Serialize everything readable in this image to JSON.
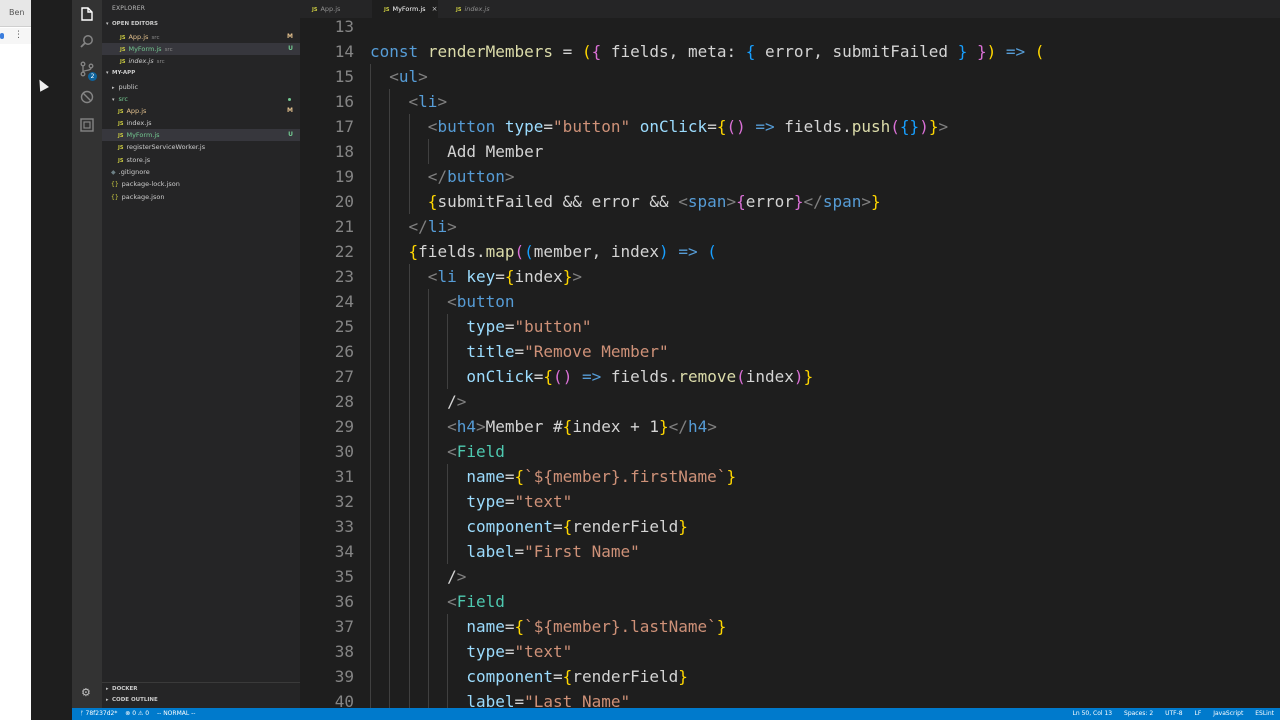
{
  "browser": {
    "user": "Ben",
    "menu_icon": "kebab-menu-icon"
  },
  "activity_bar": {
    "icons": [
      "files-icon",
      "search-icon",
      "source-control-icon",
      "debug-icon",
      "extensions-icon"
    ],
    "scm_badge": "2",
    "manage_icon": "gear-icon"
  },
  "sidebar": {
    "title": "EXPLORER",
    "open_editors": {
      "label": "OPEN EDITORS",
      "items": [
        {
          "name": "App.js",
          "dir": "src",
          "status": "M"
        },
        {
          "name": "MyForm.js",
          "dir": "src",
          "status": "U"
        },
        {
          "name": "index.js",
          "dir": "src",
          "status": ""
        }
      ]
    },
    "project": {
      "label": "MY-APP",
      "items": [
        {
          "name": "public",
          "status": ""
        },
        {
          "name": "src",
          "status": ""
        },
        {
          "name": "App.js",
          "status": "M"
        },
        {
          "name": "index.js",
          "status": ""
        },
        {
          "name": "MyForm.js",
          "status": "U"
        },
        {
          "name": "registerServiceWorker.js",
          "status": ""
        },
        {
          "name": "store.js",
          "status": ""
        },
        {
          "name": ".gitignore",
          "status": ""
        },
        {
          "name": "package-lock.json",
          "status": ""
        },
        {
          "name": "package.json",
          "status": ""
        }
      ]
    },
    "docker_label": "DOCKER",
    "outline_label": "CODE OUTLINE"
  },
  "tabs": [
    {
      "label": "App.js",
      "active": false
    },
    {
      "label": "MyForm.js",
      "active": true,
      "close": "×"
    },
    {
      "label": "index.js",
      "active": false
    }
  ],
  "editor": {
    "lines": [
      {
        "n": "13",
        "text": ""
      },
      {
        "n": "14",
        "text": "const renderMembers = ({ fields, meta: { error, submitFailed } }) => ("
      },
      {
        "n": "15",
        "text": "  <ul>"
      },
      {
        "n": "16",
        "text": "    <li>"
      },
      {
        "n": "17",
        "text": "      <button type=\"button\" onClick={() => fields.push({})}>"
      },
      {
        "n": "18",
        "text": "        Add Member"
      },
      {
        "n": "19",
        "text": "      </button>"
      },
      {
        "n": "20",
        "text": "      {submitFailed && error && <span>{error}</span>}"
      },
      {
        "n": "21",
        "text": "    </li>"
      },
      {
        "n": "22",
        "text": "    {fields.map((member, index) => ("
      },
      {
        "n": "23",
        "text": "      <li key={index}>"
      },
      {
        "n": "24",
        "text": "        <button"
      },
      {
        "n": "25",
        "text": "          type=\"button\""
      },
      {
        "n": "26",
        "text": "          title=\"Remove Member\""
      },
      {
        "n": "27",
        "text": "          onClick={() => fields.remove(index)}"
      },
      {
        "n": "28",
        "text": "        />"
      },
      {
        "n": "29",
        "text": "        <h4>Member #{index + 1}</h4>"
      },
      {
        "n": "30",
        "text": "        <Field"
      },
      {
        "n": "31",
        "text": "          name={`${member}.firstName`}"
      },
      {
        "n": "32",
        "text": "          type=\"text\""
      },
      {
        "n": "33",
        "text": "          component={renderField}"
      },
      {
        "n": "34",
        "text": "          label=\"First Name\""
      },
      {
        "n": "35",
        "text": "        />"
      },
      {
        "n": "36",
        "text": "        <Field"
      },
      {
        "n": "37",
        "text": "          name={`${member}.lastName`}"
      },
      {
        "n": "38",
        "text": "          type=\"text\""
      },
      {
        "n": "39",
        "text": "          component={renderField}"
      },
      {
        "n": "40",
        "text": "          label=\"Last Name\""
      }
    ]
  },
  "status_bar": {
    "branch": "ᚠ 78f237d2*",
    "problems": "⊗ 0 ⚠ 0",
    "mode": "-- NORMAL --",
    "position": "Ln 50, Col 13",
    "spaces": "Spaces: 2",
    "encoding": "UTF-8",
    "eol": "LF",
    "language": "JavaScript",
    "linter": "ESLint"
  }
}
